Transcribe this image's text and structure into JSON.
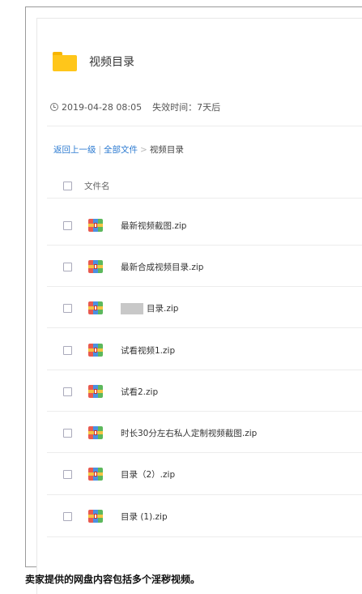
{
  "folder": {
    "title": "视频目录",
    "icon": "folder-icon"
  },
  "meta": {
    "date": "2019-04-28 08:05",
    "expiry_label": "失效时间：",
    "expiry_value": "7天后"
  },
  "breadcrumb": {
    "back": "返回上一级",
    "all_files": "全部文件",
    "separator": ">",
    "current": "视频目录"
  },
  "list": {
    "header": "文件名",
    "files": [
      {
        "name": "最新视频截图.zip"
      },
      {
        "name": "最新合成视频目录.zip"
      },
      {
        "name": "目录.zip",
        "redacted_prefix": true
      },
      {
        "name": "试看视频1.zip"
      },
      {
        "name": "试看2.zip"
      },
      {
        "name": "时长30分左右私人定制视频截图.zip"
      },
      {
        "name": "目录（2）.zip"
      },
      {
        "name": "目录 (1).zip"
      }
    ]
  },
  "caption": "卖家提供的网盘内容包括多个淫秽视频。",
  "colors": {
    "link": "#2d7bd1",
    "folder": "#ffc61a"
  }
}
